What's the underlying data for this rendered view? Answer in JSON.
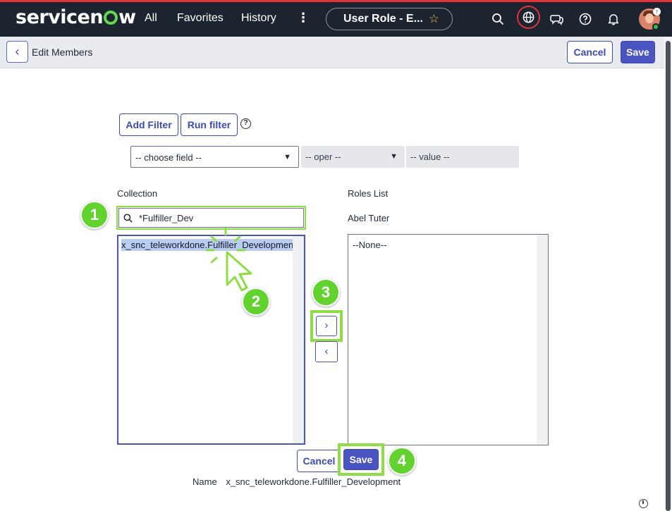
{
  "topnav": {
    "logo": {
      "pre": "service",
      "post": "w"
    },
    "links": {
      "all": "All",
      "favorites": "Favorites",
      "history": "History"
    },
    "more_glyph": "⋮",
    "context_title": "User Role - E...",
    "icons": [
      "search-icon",
      "globe-icon",
      "chat-icon",
      "help-icon",
      "bell-icon",
      "avatar"
    ]
  },
  "subheader": {
    "back_glyph": "‹",
    "title": "Edit Members",
    "cancel_label": "Cancel",
    "save_label": "Save"
  },
  "filter": {
    "add_filter_label": "Add Filter",
    "run_filter_label": "Run filter",
    "help_glyph": "?",
    "field_placeholder": "-- choose field --",
    "oper_placeholder": "-- oper --",
    "value_placeholder": "-- value --"
  },
  "collection": {
    "label": "Collection",
    "search_value": "*Fulfiller_Dev",
    "items": [
      "x_snc_teleworkdone.Fulfiller_Development"
    ]
  },
  "roles": {
    "label": "Roles List",
    "user": "Abel Tuter",
    "items": [
      "--None--"
    ]
  },
  "slush_buttons": {
    "add_glyph": "›",
    "remove_glyph": "‹"
  },
  "footer": {
    "cancel_label": "Cancel",
    "save_label": "Save",
    "name_label": "Name",
    "name_value": "x_snc_teleworkdone.Fulfiller_Development"
  },
  "step_badges": [
    "1",
    "2",
    "3",
    "4"
  ],
  "colors": {
    "nav_bg": "#1c2430",
    "brand_green": "#62d84e",
    "primary": "#4a54c1",
    "highlight_green": "#8fdd45",
    "alert_red": "#e0333a"
  }
}
